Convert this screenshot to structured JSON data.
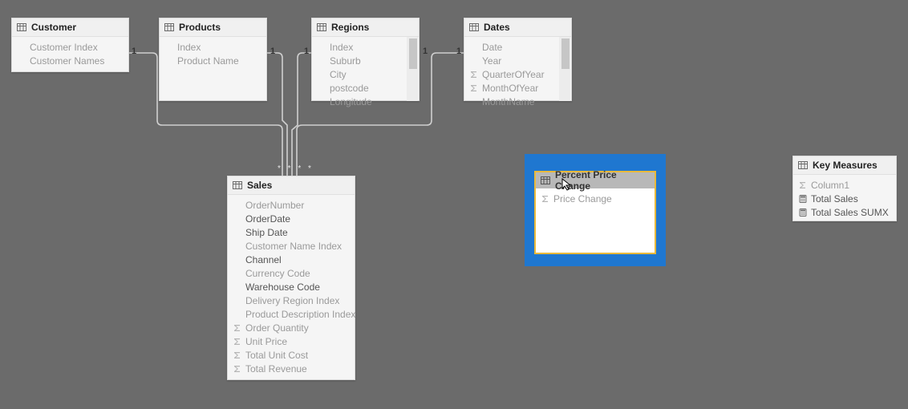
{
  "tables": {
    "customer": {
      "title": "Customer",
      "fields": [
        {
          "label": "Customer Index",
          "dim": true,
          "icon": null
        },
        {
          "label": "Customer Names",
          "dim": true,
          "icon": null
        }
      ]
    },
    "products": {
      "title": "Products",
      "fields": [
        {
          "label": "Index",
          "dim": true,
          "icon": null
        },
        {
          "label": "Product Name",
          "dim": true,
          "icon": null
        }
      ]
    },
    "regions": {
      "title": "Regions",
      "fields": [
        {
          "label": "Index",
          "dim": true,
          "icon": null
        },
        {
          "label": "Suburb",
          "dim": true,
          "icon": null
        },
        {
          "label": "City",
          "dim": true,
          "icon": null
        },
        {
          "label": "postcode",
          "dim": true,
          "icon": null
        },
        {
          "label": "Longitude",
          "dim": true,
          "icon": null
        }
      ]
    },
    "dates": {
      "title": "Dates",
      "fields": [
        {
          "label": "Date",
          "dim": true,
          "icon": null
        },
        {
          "label": "Year",
          "dim": true,
          "icon": null
        },
        {
          "label": "QuarterOfYear",
          "dim": true,
          "icon": "sigma"
        },
        {
          "label": "MonthOfYear",
          "dim": true,
          "icon": "sigma"
        },
        {
          "label": "MonthName",
          "dim": true,
          "icon": null
        }
      ]
    },
    "sales": {
      "title": "Sales",
      "fields": [
        {
          "label": "OrderNumber",
          "dim": true,
          "icon": null
        },
        {
          "label": "OrderDate",
          "dim": false,
          "icon": null
        },
        {
          "label": "Ship Date",
          "dim": false,
          "icon": null
        },
        {
          "label": "Customer Name Index",
          "dim": true,
          "icon": null
        },
        {
          "label": "Channel",
          "dim": false,
          "icon": null
        },
        {
          "label": "Currency Code",
          "dim": true,
          "icon": null
        },
        {
          "label": "Warehouse Code",
          "dim": false,
          "icon": null
        },
        {
          "label": "Delivery Region Index",
          "dim": true,
          "icon": null
        },
        {
          "label": "Product Description Index",
          "dim": true,
          "icon": null
        },
        {
          "label": "Order Quantity",
          "dim": true,
          "icon": "sigma"
        },
        {
          "label": "Unit Price",
          "dim": true,
          "icon": "sigma"
        },
        {
          "label": "Total Unit Cost",
          "dim": true,
          "icon": "sigma"
        },
        {
          "label": "Total Revenue",
          "dim": true,
          "icon": "sigma"
        }
      ]
    },
    "percent_price_change": {
      "title": "Percent Price Change",
      "fields": [
        {
          "label": "Price Change",
          "dim": true,
          "icon": "sigma"
        }
      ]
    },
    "key_measures": {
      "title": "Key Measures",
      "fields": [
        {
          "label": "Column1",
          "dim": true,
          "icon": "sigma"
        },
        {
          "label": "Total Sales",
          "dim": false,
          "icon": "calc"
        },
        {
          "label": "Total Sales SUMX",
          "dim": false,
          "icon": "calc"
        }
      ]
    }
  },
  "relationship_cardinality": {
    "customer_side": "1",
    "products_side": "1",
    "regions_left": "1",
    "regions_right": "1",
    "dates_side": "1",
    "sales_side": "* * * *"
  }
}
